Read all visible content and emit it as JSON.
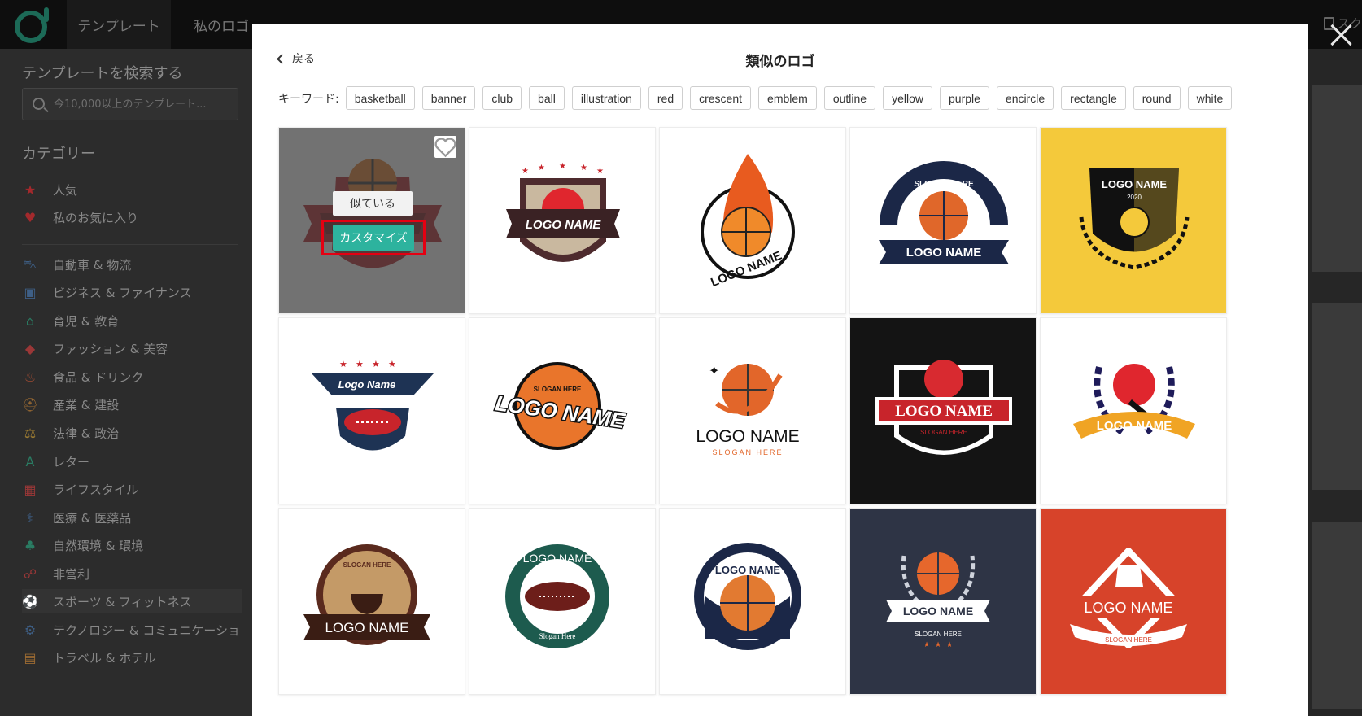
{
  "topbar": {
    "nav_templates": "テンプレート",
    "nav_my_logos": "私のロゴ",
    "right_fragment": "スク"
  },
  "sidebar": {
    "search_heading": "テンプレートを検索する",
    "search_placeholder": "今10,000以上のテンプレート...",
    "category_heading": "カテゴリー",
    "items": [
      {
        "label": "人気",
        "icon": "star-badge-icon",
        "color": "#a3292c"
      },
      {
        "label": "私のお気に入り",
        "icon": "heart-icon",
        "color": "#a3292c"
      },
      {
        "label": "自動車 & 物流",
        "icon": "car-icon",
        "color": "#3e5f86"
      },
      {
        "label": "ビジネス & ファイナンス",
        "icon": "briefcase-icon",
        "color": "#3e5f86"
      },
      {
        "label": "育児 & 教育",
        "icon": "graduation-cap-icon",
        "color": "#2a7c63"
      },
      {
        "label": "ファッション & 美容",
        "icon": "diamond-icon",
        "color": "#9a3737"
      },
      {
        "label": "食品 & ドリンク",
        "icon": "chef-hat-icon",
        "color": "#9a4a32"
      },
      {
        "label": "産業 & 建設",
        "icon": "helmet-icon",
        "color": "#9a6a32"
      },
      {
        "label": "法律 & 政治",
        "icon": "scales-icon",
        "color": "#9a7a32"
      },
      {
        "label": "レター",
        "icon": "letter-a-icon",
        "color": "#2a7c63"
      },
      {
        "label": "ライフスタイル",
        "icon": "gift-icon",
        "color": "#9a3737"
      },
      {
        "label": "医療 & 医薬品",
        "icon": "stethoscope-icon",
        "color": "#3e5f86"
      },
      {
        "label": "自然環境 & 環境",
        "icon": "tree-icon",
        "color": "#2a7c63"
      },
      {
        "label": "非営利",
        "icon": "ribbon-icon",
        "color": "#9a3737"
      },
      {
        "label": "スポーツ & フィットネス",
        "icon": "soccer-ball-icon",
        "color": "#3e5f86"
      },
      {
        "label": "テクノロジー & コミュニケーション",
        "icon": "gear-icon",
        "color": "#3e5f86"
      },
      {
        "label": "トラベル & ホテル",
        "icon": "hotel-icon",
        "color": "#9a6a32"
      }
    ]
  },
  "modal": {
    "back_label": "戻る",
    "title": "類似のロゴ",
    "keyword_label": "キーワード:",
    "keywords": [
      "basketball",
      "banner",
      "club",
      "ball",
      "illustration",
      "red",
      "crescent",
      "emblem",
      "outline",
      "yellow",
      "purple",
      "encircle",
      "rectangle",
      "round",
      "white"
    ],
    "hover_similar_label": "似ている",
    "hover_customize_label": "カスタマイズ"
  },
  "logo_texts": {
    "logo_name_caps": "LOGO NAME",
    "logo_name_mixed": "Logo Name",
    "slogan_here": "SLOGAN HERE",
    "slogan_here_mixed": "Slogan Here",
    "slogan_word": "SLOGAN",
    "here_word": "HERE",
    "year": "2020",
    "logo_word": "LOGO",
    "name_word": "NAME"
  },
  "colors": {
    "accent_teal": "#2db39e",
    "highlight_red": "#e50012",
    "brand_green": "#1c6a57"
  }
}
